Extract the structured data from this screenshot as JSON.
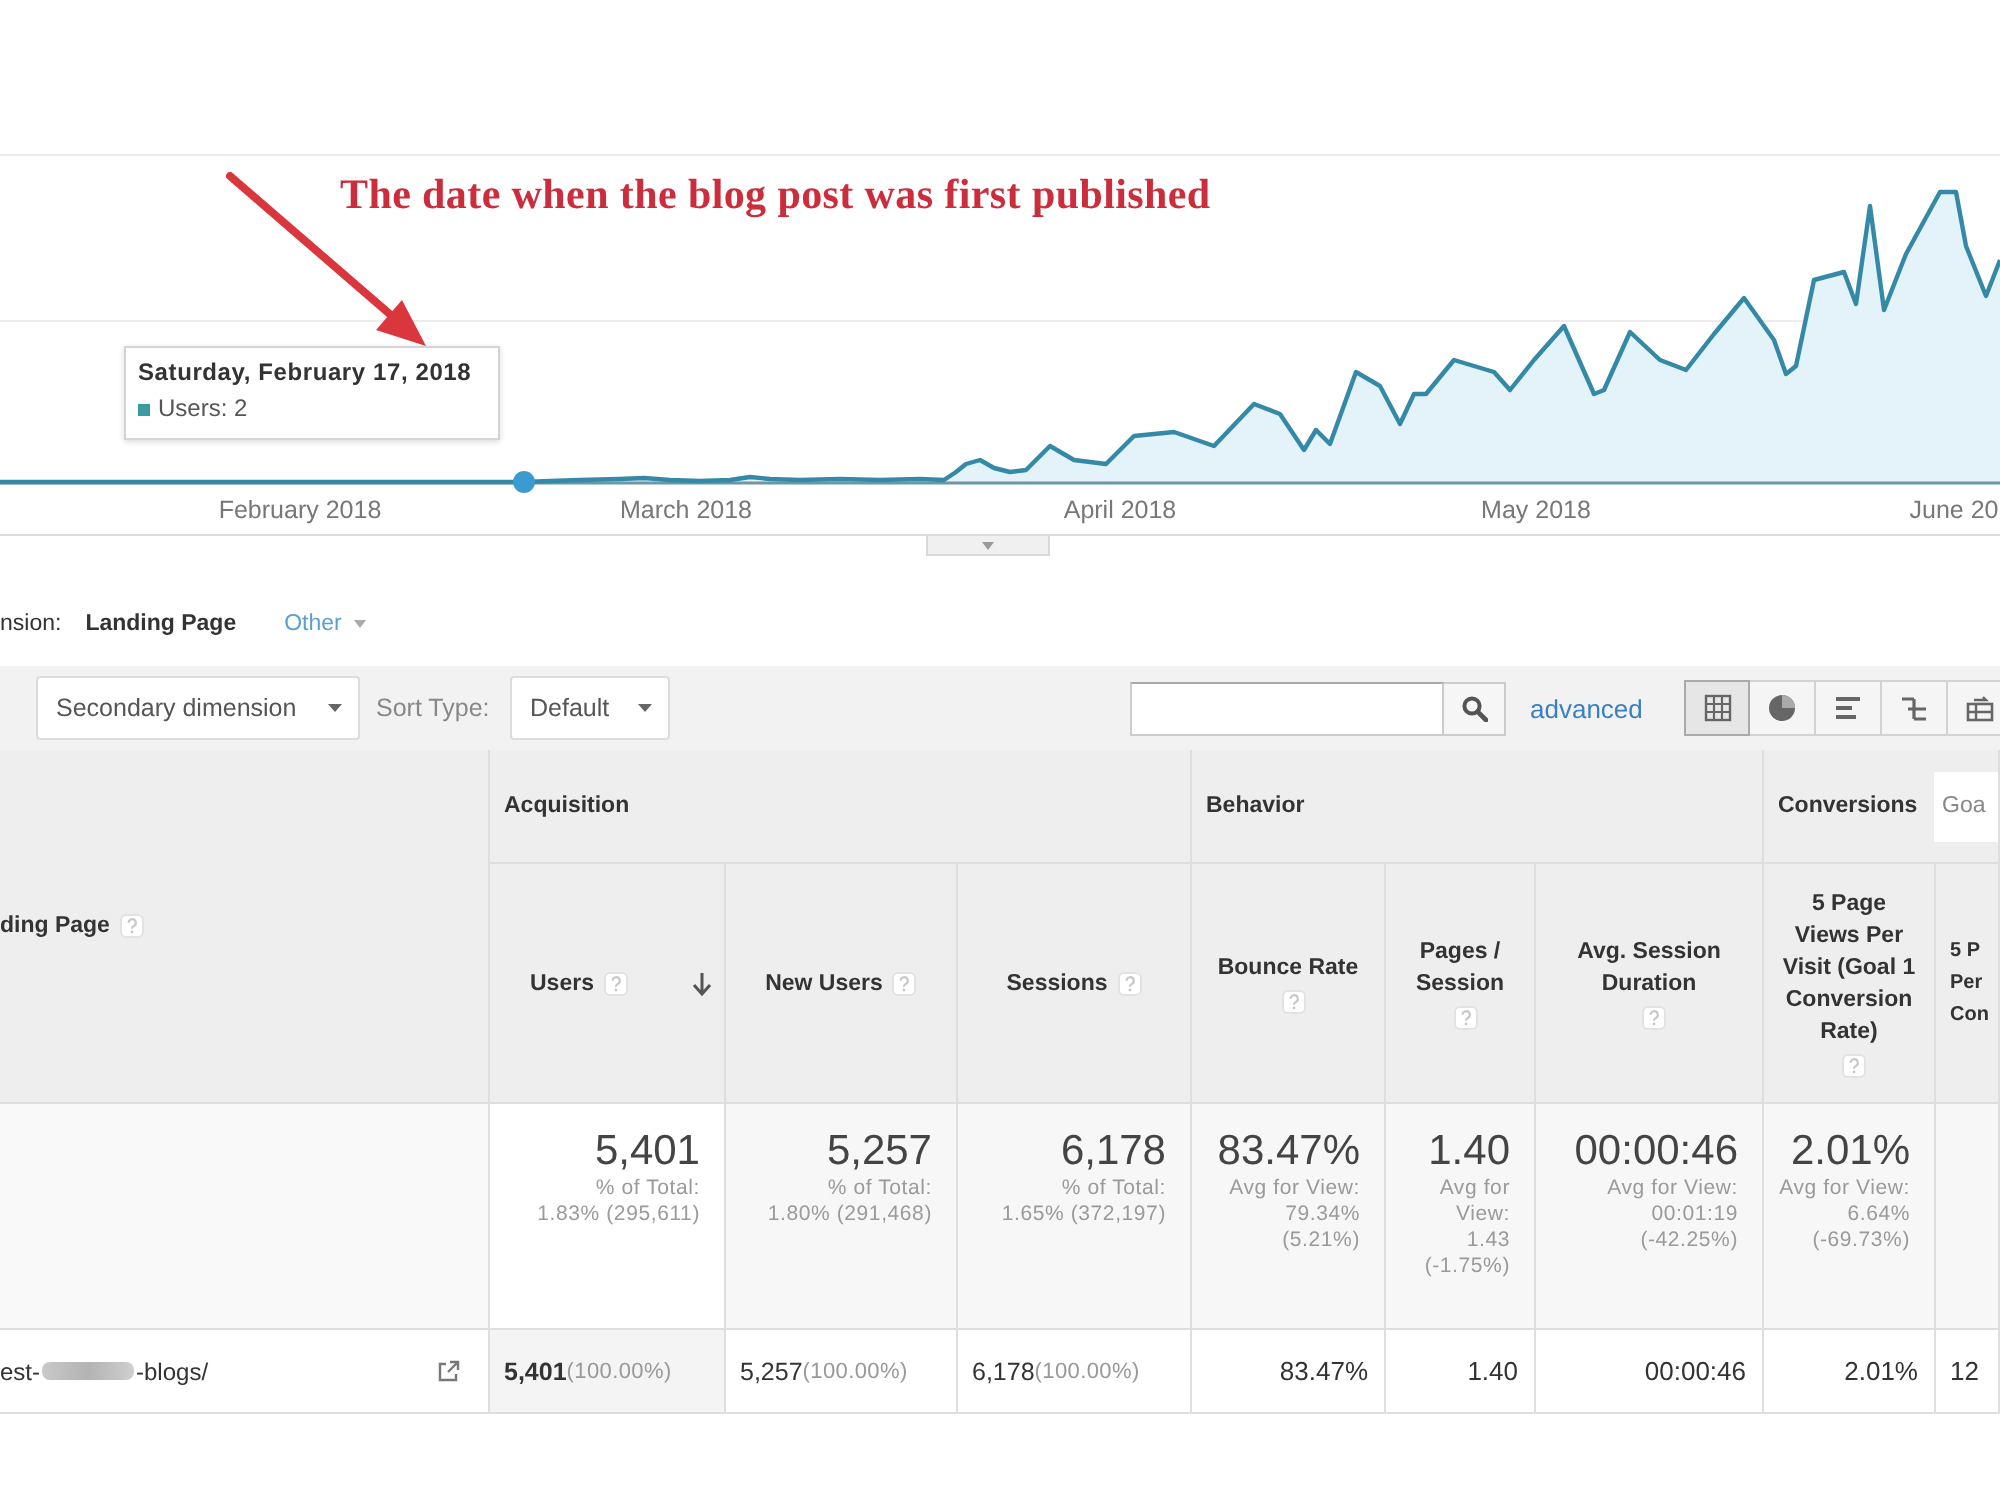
{
  "chart": {
    "annotation": "The date when the blog post was first published",
    "tooltip": {
      "title": "Saturday, February 17, 2018",
      "text": "Users: 2"
    },
    "x_labels": [
      "February 2018",
      "March 2018",
      "April 2018",
      "May 2018",
      "June 20"
    ]
  },
  "dimension_bar": {
    "label": "nsion:",
    "options": [
      {
        "label": "Landing Page",
        "selected": true,
        "kind": "link"
      },
      {
        "label": "Other",
        "selected": false,
        "kind": "menu"
      }
    ]
  },
  "toolbar": {
    "secondary_dimension": "Secondary dimension",
    "sort_label": "Sort Type:",
    "sort_value": "Default",
    "advanced": "advanced",
    "views": [
      {
        "kind": "grid",
        "selected": true
      },
      {
        "kind": "pie",
        "selected": false
      },
      {
        "kind": "bars",
        "selected": false
      },
      {
        "kind": "comparison",
        "selected": false
      },
      {
        "kind": "pivot",
        "selected": false
      }
    ]
  },
  "table": {
    "first_column": "ding Page",
    "groups": [
      {
        "label": "Acquisition",
        "columns": [
          {
            "label": "Users",
            "sorted": true
          },
          {
            "label": "New Users",
            "sorted": false
          },
          {
            "label": "Sessions",
            "sorted": false
          }
        ]
      },
      {
        "label": "Behavior",
        "columns": [
          {
            "label": "Bounce Rate",
            "sorted": false
          },
          {
            "label": "Pages / Session",
            "sorted": false
          },
          {
            "label": "Avg. Session Duration",
            "sorted": false
          }
        ]
      },
      {
        "label": "Conversions",
        "goal_dropdown": "Goa",
        "columns": [
          {
            "label": "5 Page Views Per Visit (Goal 1 Conversion Rate)",
            "sorted": false
          },
          {
            "label": "5 P Per Con",
            "sorted": false
          }
        ]
      }
    ],
    "totals": [
      {
        "value": "5,401",
        "note": [
          "% of Total:",
          "1.83% (295,611)"
        ]
      },
      {
        "value": "5,257",
        "note": [
          "% of Total:",
          "1.80% (291,468)"
        ]
      },
      {
        "value": "6,178",
        "note": [
          "% of Total:",
          "1.65% (372,197)"
        ]
      },
      {
        "value": "83.47%",
        "note": [
          "Avg for View:",
          "79.34%",
          "(5.21%)"
        ]
      },
      {
        "value": "1.40",
        "note": [
          "Avg for View:",
          "1.43",
          "(-1.75%)"
        ]
      },
      {
        "value": "00:00:46",
        "note": [
          "Avg for View:",
          "00:01:19",
          "(-42.25%)"
        ]
      },
      {
        "value": "2.01%",
        "note": [
          "Avg for View:",
          "6.64%",
          "(-69.73%)"
        ]
      }
    ],
    "rows": [
      {
        "landing_page": {
          "start": "est-",
          "end": "-blogs/"
        },
        "cells": [
          {
            "value": "5,401",
            "share": "(100.00%)"
          },
          {
            "value": "5,257",
            "share": "(100.00%)"
          },
          {
            "value": "6,178",
            "share": "(100.00%)"
          },
          {
            "value": "83.47%"
          },
          {
            "value": "1.40"
          },
          {
            "value": "00:00:46"
          },
          {
            "value": "2.01%"
          },
          {
            "value": "12"
          }
        ]
      }
    ]
  }
}
